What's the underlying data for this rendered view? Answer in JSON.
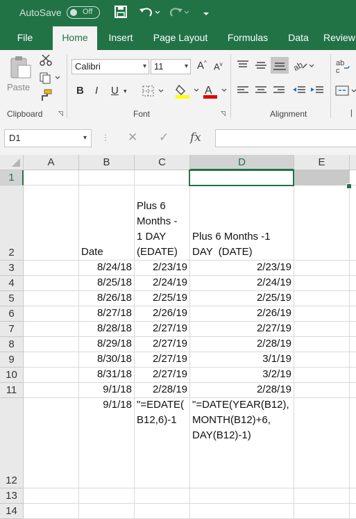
{
  "titlebar": {
    "autosave_label": "AutoSave",
    "autosave_state": "Off"
  },
  "tabs": [
    "File",
    "Home",
    "Insert",
    "Page Layout",
    "Formulas",
    "Data",
    "Review"
  ],
  "ribbon": {
    "clipboard": {
      "paste_label": "Paste",
      "group_label": "Clipboard"
    },
    "font": {
      "font_name": "Calibri",
      "font_size": "11",
      "group_label": "Font",
      "bold": "B",
      "italic": "I",
      "underline": "U"
    },
    "alignment": {
      "group_label": "Alignment"
    }
  },
  "formula_bar": {
    "name_box": "D1",
    "fx_label": "fx",
    "formula": ""
  },
  "columns": [
    "A",
    "B",
    "C",
    "D",
    "E"
  ],
  "rows": [
    "1",
    "2",
    "3",
    "4",
    "5",
    "6",
    "7",
    "8",
    "9",
    "10",
    "11",
    "12",
    "13",
    "14"
  ],
  "cells": {
    "B2": "Date",
    "C2": "Plus 6\nMonths -\n1 DAY\n(EDATE)",
    "D2": "Plus 6 Months -1\nDAY  (DATE)",
    "B": [
      "8/24/18",
      "8/25/18",
      "8/26/18",
      "8/27/18",
      "8/28/18",
      "8/29/18",
      "8/30/18",
      "8/31/18",
      "9/1/18",
      "9/1/18"
    ],
    "C": [
      "2/23/19",
      "2/24/19",
      "2/25/19",
      "2/26/19",
      "2/27/19",
      "2/27/19",
      "2/27/19",
      "2/27/19",
      "2/28/19"
    ],
    "D": [
      "2/23/19",
      "2/24/19",
      "2/25/19",
      "2/26/19",
      "2/27/19",
      "2/28/19",
      "3/1/19",
      "3/2/19",
      "2/28/19"
    ],
    "C12": "\"=EDATE(\nB12,6)-1",
    "D12": "\"=DATE(YEAR(B12),\nMONTH(B12)+6,\nDAY(B12)-1)"
  },
  "colors": {
    "accent": "#217346",
    "ribbon_bg": "#f3f3f3",
    "header_bg": "#e9e9e9"
  }
}
